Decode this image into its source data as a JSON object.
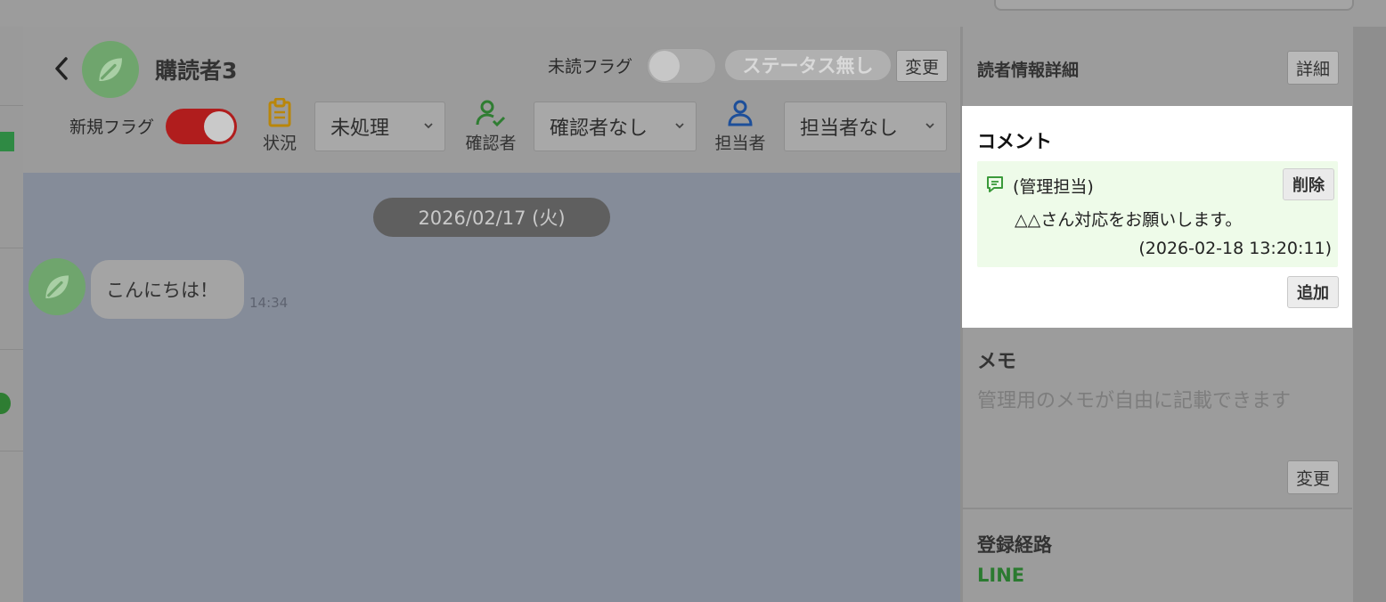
{
  "header": {
    "name": "購読者3",
    "unread_flag_label": "未読フラグ",
    "status_pill": "ステータス無し",
    "change_label": "変更",
    "new_flag_label": "新規フラグ",
    "status_field_label": "状況",
    "status_value": "未処理",
    "checker_field_label": "確認者",
    "checker_value": "確認者なし",
    "assignee_field_label": "担当者",
    "assignee_value": "担当者なし"
  },
  "chat": {
    "date": "2026/02/17 (火)",
    "messages": [
      {
        "text": "こんにちは！",
        "time": "14:34"
      }
    ]
  },
  "sidebar": {
    "title": "読者情報詳細",
    "detail_label": "詳細",
    "comment": {
      "title": "コメント",
      "items": [
        {
          "author": "(管理担当)",
          "body": "△△さん対応をお願いします。",
          "timestamp": "(2026-02-18 13:20:11)",
          "delete_label": "削除"
        }
      ],
      "add_label": "追加"
    },
    "memo": {
      "title": "メモ",
      "placeholder": "管理用のメモが自由に記載できます",
      "change_label": "変更"
    },
    "route": {
      "title": "登録経路",
      "value": "LINE"
    }
  },
  "colors": {
    "accent_green": "#2b7a30",
    "new_flag_on": "#b01d1d",
    "comment_bg": "#eefbe9"
  },
  "icons": {
    "back": "chevron-left-icon",
    "avatar": "leaf-icon",
    "status": "clipboard-icon",
    "checker": "user-check-icon",
    "assignee": "user-icon",
    "comment": "comment-icon",
    "dropdown": "chevron-down-icon"
  }
}
